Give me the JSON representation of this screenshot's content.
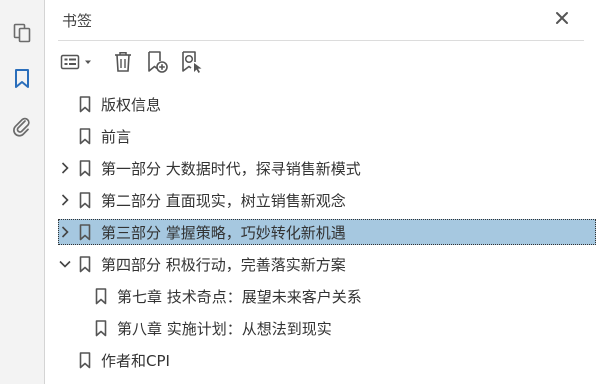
{
  "panel": {
    "title": "书签",
    "close_icon": "close-icon"
  },
  "rail": {
    "items": [
      {
        "name": "pages",
        "icon": "pages-icon"
      },
      {
        "name": "bookmarks",
        "icon": "bookmark-icon",
        "active": true
      },
      {
        "name": "attachments",
        "icon": "paperclip-icon"
      }
    ]
  },
  "toolbar": {
    "options_icon": "options-menu-icon",
    "delete_icon": "trash-icon",
    "new_icon": "add-bookmark-icon",
    "find_icon": "find-bookmark-icon"
  },
  "colors": {
    "selected_bg": "#a6c8e0",
    "accent": "#2a6ebb"
  },
  "bookmarks": [
    {
      "label": "版权信息",
      "level": 0,
      "state": "none"
    },
    {
      "label": "前言",
      "level": 0,
      "state": "none"
    },
    {
      "label": "第一部分 大数据时代，探寻销售新模式",
      "level": 0,
      "state": "collapsed"
    },
    {
      "label": "第二部分 直面现实，树立销售新观念",
      "level": 0,
      "state": "collapsed"
    },
    {
      "label": "第三部分 掌握策略，巧妙转化新机遇",
      "level": 0,
      "state": "collapsed",
      "selected": true
    },
    {
      "label": "第四部分 积极行动，完善落实新方案",
      "level": 0,
      "state": "expanded"
    },
    {
      "label": "第七章 技术奇点：展望未来客户关系",
      "level": 1,
      "state": "none"
    },
    {
      "label": "第八章 实施计划：从想法到现实",
      "level": 1,
      "state": "none"
    },
    {
      "label": "作者和CPI",
      "level": 0,
      "state": "none"
    }
  ]
}
